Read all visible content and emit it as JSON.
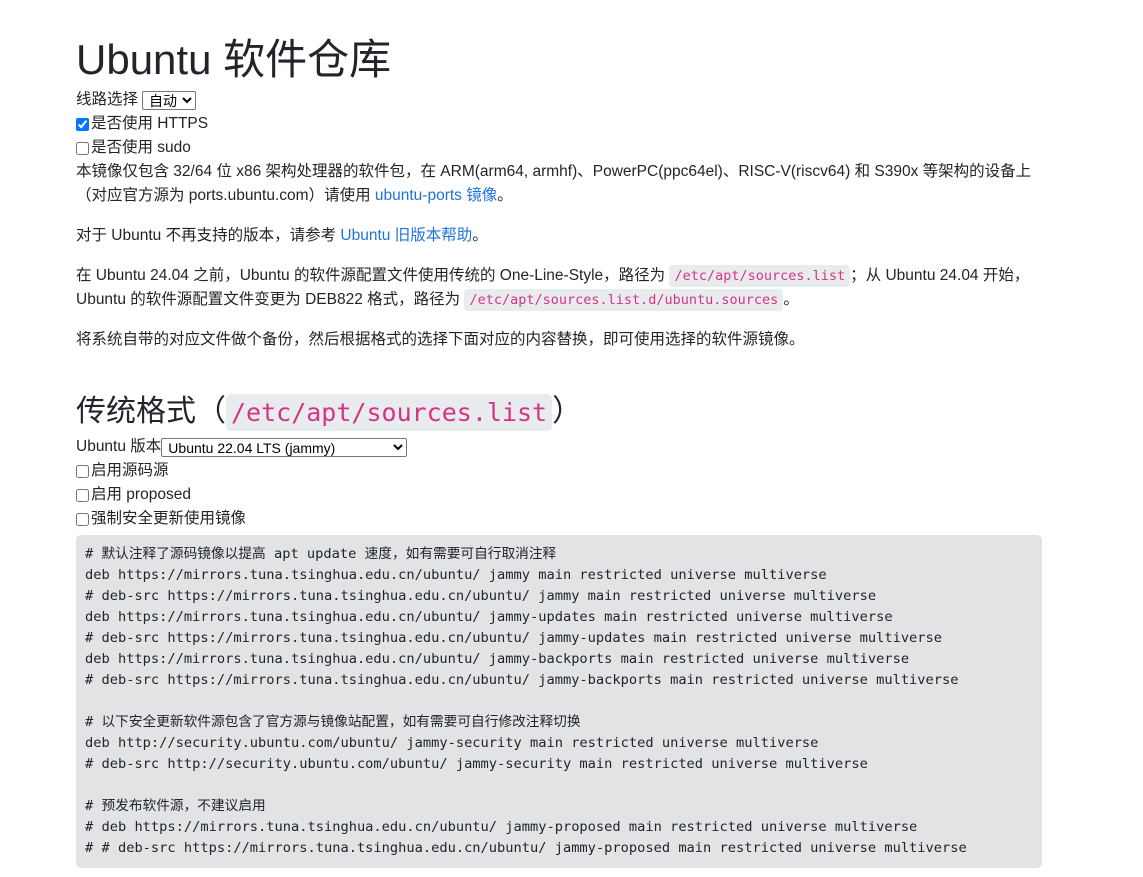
{
  "page": {
    "title": "Ubuntu 软件仓库"
  },
  "options": {
    "line_label": "线路选择",
    "line_selected": "自动",
    "https_label": "是否使用 HTTPS",
    "https_checked": true,
    "sudo_label": "是否使用 sudo",
    "sudo_checked": false
  },
  "intro": {
    "p1_text": "本镜像仅包含 32/64 位 x86 架构处理器的软件包，在 ARM(arm64, armhf)、PowerPC(ppc64el)、RISC-V(riscv64) 和 S390x 等架构的设备上（对应官方源为 ports.ubuntu.com）请使用 ",
    "p1_link": "ubuntu-ports 镜像",
    "p1_end": "。",
    "p2_text": "对于 Ubuntu 不再支持的版本，请参考 ",
    "p2_link": "Ubuntu 旧版本帮助",
    "p2_end": "。",
    "p3_a": "在 Ubuntu 24.04 之前，Ubuntu 的软件源配置文件使用传统的 One-Line-Style，路径为 ",
    "p3_code1": "/etc/apt/sources.list",
    "p3_b": "；从 Ubuntu 24.04 开始，Ubuntu 的软件源配置文件变更为 DEB822 格式，路径为 ",
    "p3_code2": "/etc/apt/sources.list.d/ubuntu.sources",
    "p3_c": "。",
    "p4_text": "将系统自带的对应文件做个备份，然后根据格式的选择下面对应的内容替换，即可使用选择的软件源镜像。"
  },
  "section": {
    "heading_prefix": "传统格式（",
    "heading_code": "/etc/apt/sources.list",
    "heading_suffix": "）",
    "version_label": "Ubuntu 版本",
    "version_selected": "Ubuntu 22.04 LTS (jammy)",
    "src_label": "启用源码源",
    "src_checked": false,
    "proposed_label": "启用 proposed",
    "proposed_checked": false,
    "security_label": "强制安全更新使用镜像",
    "security_checked": false
  },
  "sources_lines": [
    "# 默认注释了源码镜像以提高 apt update 速度，如有需要可自行取消注释",
    "deb https://mirrors.tuna.tsinghua.edu.cn/ubuntu/ jammy main restricted universe multiverse",
    "# deb-src https://mirrors.tuna.tsinghua.edu.cn/ubuntu/ jammy main restricted universe multiverse",
    "deb https://mirrors.tuna.tsinghua.edu.cn/ubuntu/ jammy-updates main restricted universe multiverse",
    "# deb-src https://mirrors.tuna.tsinghua.edu.cn/ubuntu/ jammy-updates main restricted universe multiverse",
    "deb https://mirrors.tuna.tsinghua.edu.cn/ubuntu/ jammy-backports main restricted universe multiverse",
    "# deb-src https://mirrors.tuna.tsinghua.edu.cn/ubuntu/ jammy-backports main restricted universe multiverse",
    "",
    "# 以下安全更新软件源包含了官方源与镜像站配置，如有需要可自行修改注释切换",
    "deb http://security.ubuntu.com/ubuntu/ jammy-security main restricted universe multiverse",
    "# deb-src http://security.ubuntu.com/ubuntu/ jammy-security main restricted universe multiverse",
    "",
    "# 预发布软件源，不建议启用",
    "# deb https://mirrors.tuna.tsinghua.edu.cn/ubuntu/ jammy-proposed main restricted universe multiverse",
    "# # deb-src https://mirrors.tuna.tsinghua.edu.cn/ubuntu/ jammy-proposed main restricted universe multiverse"
  ],
  "colors": {
    "link": "#1e73d8",
    "code_text": "#d63384",
    "code_bg": "#e9ecef",
    "pre_bg": "#e2e3e5"
  }
}
